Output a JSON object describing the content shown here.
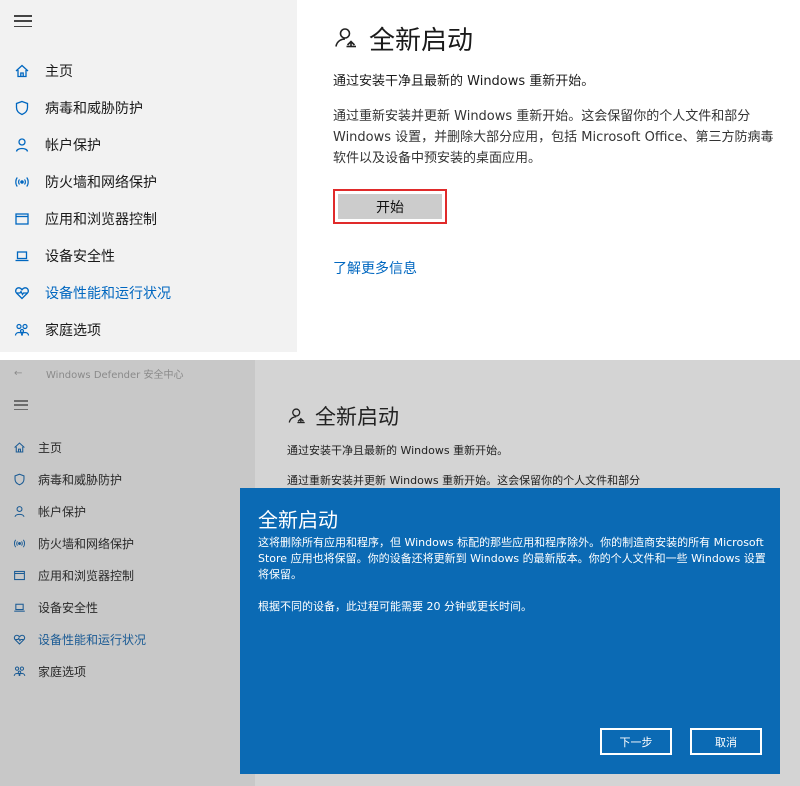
{
  "top": {
    "sidebar": {
      "items": [
        {
          "label": "主页",
          "icon": "home-icon"
        },
        {
          "label": "病毒和威胁防护",
          "icon": "shield-icon"
        },
        {
          "label": "帐户保护",
          "icon": "person-icon"
        },
        {
          "label": "防火墙和网络保护",
          "icon": "wireless-icon"
        },
        {
          "label": "应用和浏览器控制",
          "icon": "window-icon"
        },
        {
          "label": "设备安全性",
          "icon": "laptop-icon"
        },
        {
          "label": "设备性能和运行状况",
          "icon": "heart-icon"
        },
        {
          "label": "家庭选项",
          "icon": "family-icon"
        }
      ],
      "active_index": 6
    },
    "content": {
      "title": "全新启动",
      "subtitle": "通过安装干净且最新的 Windows 重新开始。",
      "description": "通过重新安装并更新 Windows 重新开始。这会保留你的个人文件和部分 Windows 设置，并删除大部分应用，包括 Microsoft Office、第三方防病毒软件以及设备中预安装的桌面应用。",
      "start_button": "开始",
      "learn_more": "了解更多信息"
    }
  },
  "bottom": {
    "window_title": "Windows Defender 安全中心",
    "back_glyph": "←",
    "sidebar": {
      "items": [
        {
          "label": "主页",
          "icon": "home-icon"
        },
        {
          "label": "病毒和威胁防护",
          "icon": "shield-icon"
        },
        {
          "label": "帐户保护",
          "icon": "person-icon"
        },
        {
          "label": "防火墙和网络保护",
          "icon": "wireless-icon"
        },
        {
          "label": "应用和浏览器控制",
          "icon": "window-icon"
        },
        {
          "label": "设备安全性",
          "icon": "laptop-icon"
        },
        {
          "label": "设备性能和运行状况",
          "icon": "heart-icon"
        },
        {
          "label": "家庭选项",
          "icon": "family-icon"
        }
      ],
      "active_index": 6
    },
    "content": {
      "title": "全新启动",
      "subtitle": "通过安装干净且最新的 Windows 重新开始。",
      "description_partial": "通过重新安装并更新 Windows 重新开始。这会保留你的个人文件和部分"
    },
    "dialog": {
      "title": "全新启动",
      "body": "这将删除所有应用和程序，但 Windows 标配的那些应用和程序除外。你的制造商安装的所有 Microsoft Store 应用也将保留。你的设备还将更新到 Windows 的最新版本。你的个人文件和一些 Windows 设置将保留。",
      "note": "根据不同的设备，此过程可能需要 20 分钟或更长时间。",
      "next_button": "下一步",
      "cancel_button": "取消"
    }
  },
  "colors": {
    "accent": "#0067c0",
    "dialog_bg": "#0b6ab4",
    "highlight_border": "#e02a2a",
    "sidebar_bg": "#f2f2f2",
    "overlay_bg": "#d4d4d4"
  }
}
